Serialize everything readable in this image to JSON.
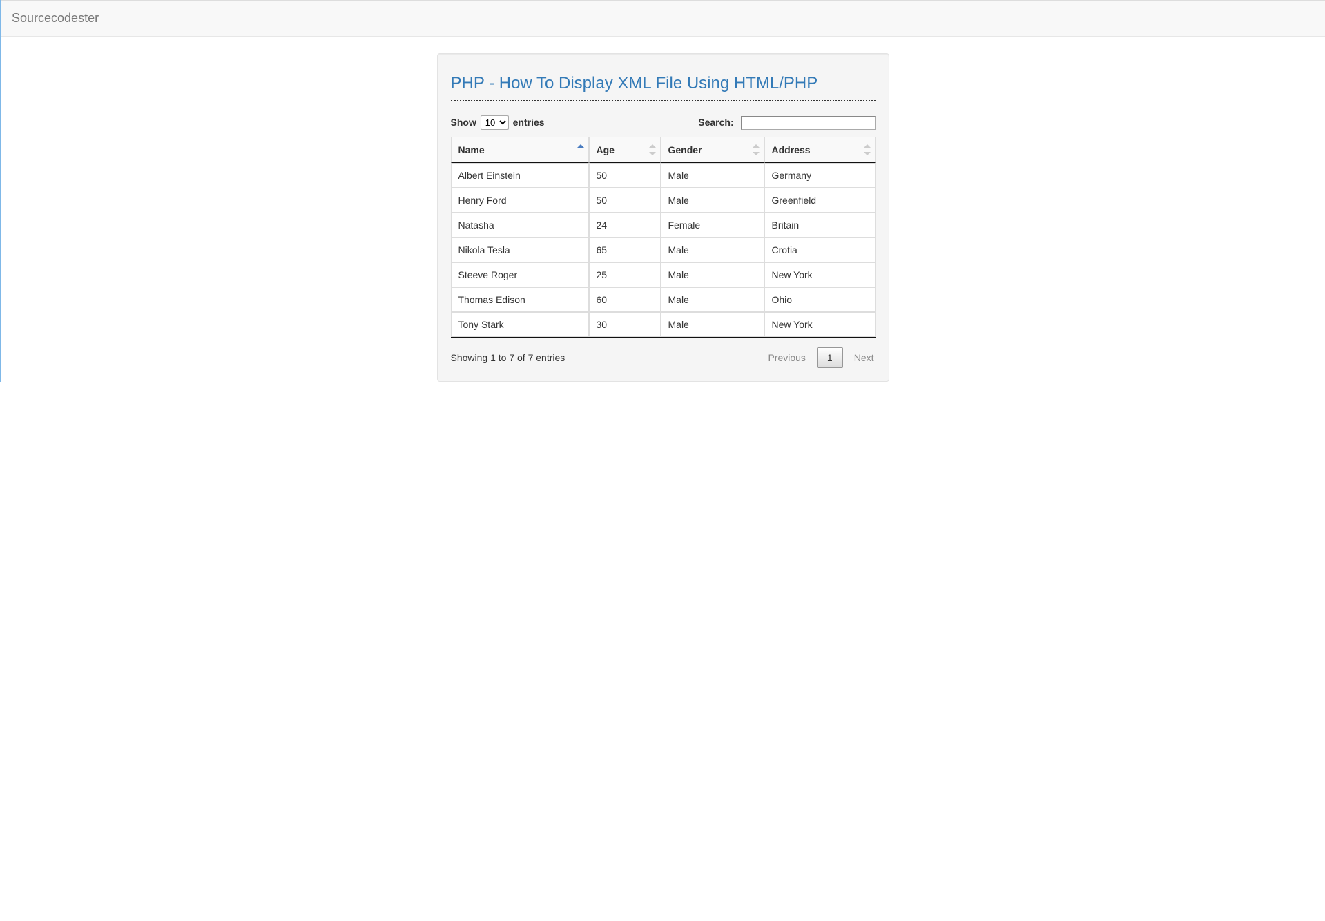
{
  "navbar": {
    "brand": "Sourcecodester"
  },
  "page": {
    "title": "PHP - How To Display XML File Using HTML/PHP"
  },
  "datatable": {
    "length": {
      "show_label": "Show",
      "entries_label": "entries",
      "selected": "10"
    },
    "search": {
      "label": "Search:"
    },
    "columns": [
      "Name",
      "Age",
      "Gender",
      "Address"
    ],
    "rows": [
      {
        "name": "Albert Einstein",
        "age": "50",
        "gender": "Male",
        "address": "Germany"
      },
      {
        "name": "Henry Ford",
        "age": "50",
        "gender": "Male",
        "address": "Greenfield"
      },
      {
        "name": "Natasha",
        "age": "24",
        "gender": "Female",
        "address": "Britain"
      },
      {
        "name": "Nikola Tesla",
        "age": "65",
        "gender": "Male",
        "address": "Crotia"
      },
      {
        "name": "Steeve Roger",
        "age": "25",
        "gender": "Male",
        "address": "New York"
      },
      {
        "name": "Thomas Edison",
        "age": "60",
        "gender": "Male",
        "address": "Ohio"
      },
      {
        "name": "Tony Stark",
        "age": "30",
        "gender": "Male",
        "address": "New York"
      }
    ],
    "info": "Showing 1 to 7 of 7 entries",
    "paginate": {
      "previous": "Previous",
      "page": "1",
      "next": "Next"
    }
  }
}
